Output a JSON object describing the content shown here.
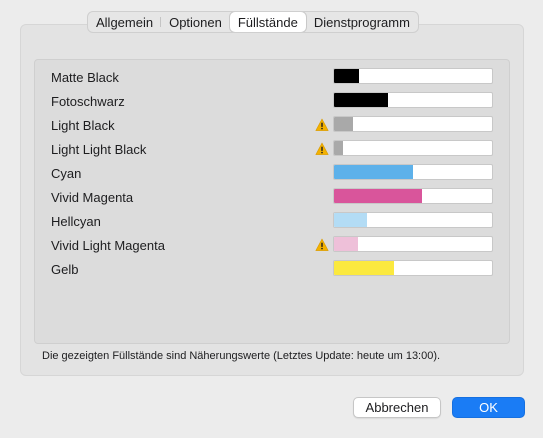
{
  "tabs": [
    {
      "label": "Allgemein",
      "active": false
    },
    {
      "label": "Optionen",
      "active": false
    },
    {
      "label": "Füllstände",
      "active": true
    },
    {
      "label": "Dienstprogramm",
      "active": false
    }
  ],
  "colors": {
    "accent": "#1a7cf5",
    "warning": "#f3b100"
  },
  "levels": [
    {
      "name": "Matte Black",
      "level": 0.16,
      "color": "#000000",
      "warning": false
    },
    {
      "name": "Fotoschwarz",
      "level": 0.34,
      "color": "#000000",
      "warning": false
    },
    {
      "name": "Light Black",
      "level": 0.12,
      "color": "#a9a9a9",
      "warning": true
    },
    {
      "name": "Light Light Black",
      "level": 0.06,
      "color": "#a9a9a9",
      "warning": true
    },
    {
      "name": "Cyan",
      "level": 0.5,
      "color": "#5db1ea",
      "warning": false
    },
    {
      "name": "Vivid Magenta",
      "level": 0.56,
      "color": "#d9559b",
      "warning": false
    },
    {
      "name": "Hellcyan",
      "level": 0.21,
      "color": "#b3dcf5",
      "warning": false
    },
    {
      "name": "Vivid Light Magenta",
      "level": 0.15,
      "color": "#eec0d9",
      "warning": true
    },
    {
      "name": "Gelb",
      "level": 0.38,
      "color": "#fbe93f",
      "warning": false
    }
  ],
  "note": "Die gezeigten Füllstände sind Näherungswerte (Letztes Update: heute um 13:00).",
  "buttons": {
    "cancel_label": "Abbrechen",
    "ok_label": "OK"
  }
}
